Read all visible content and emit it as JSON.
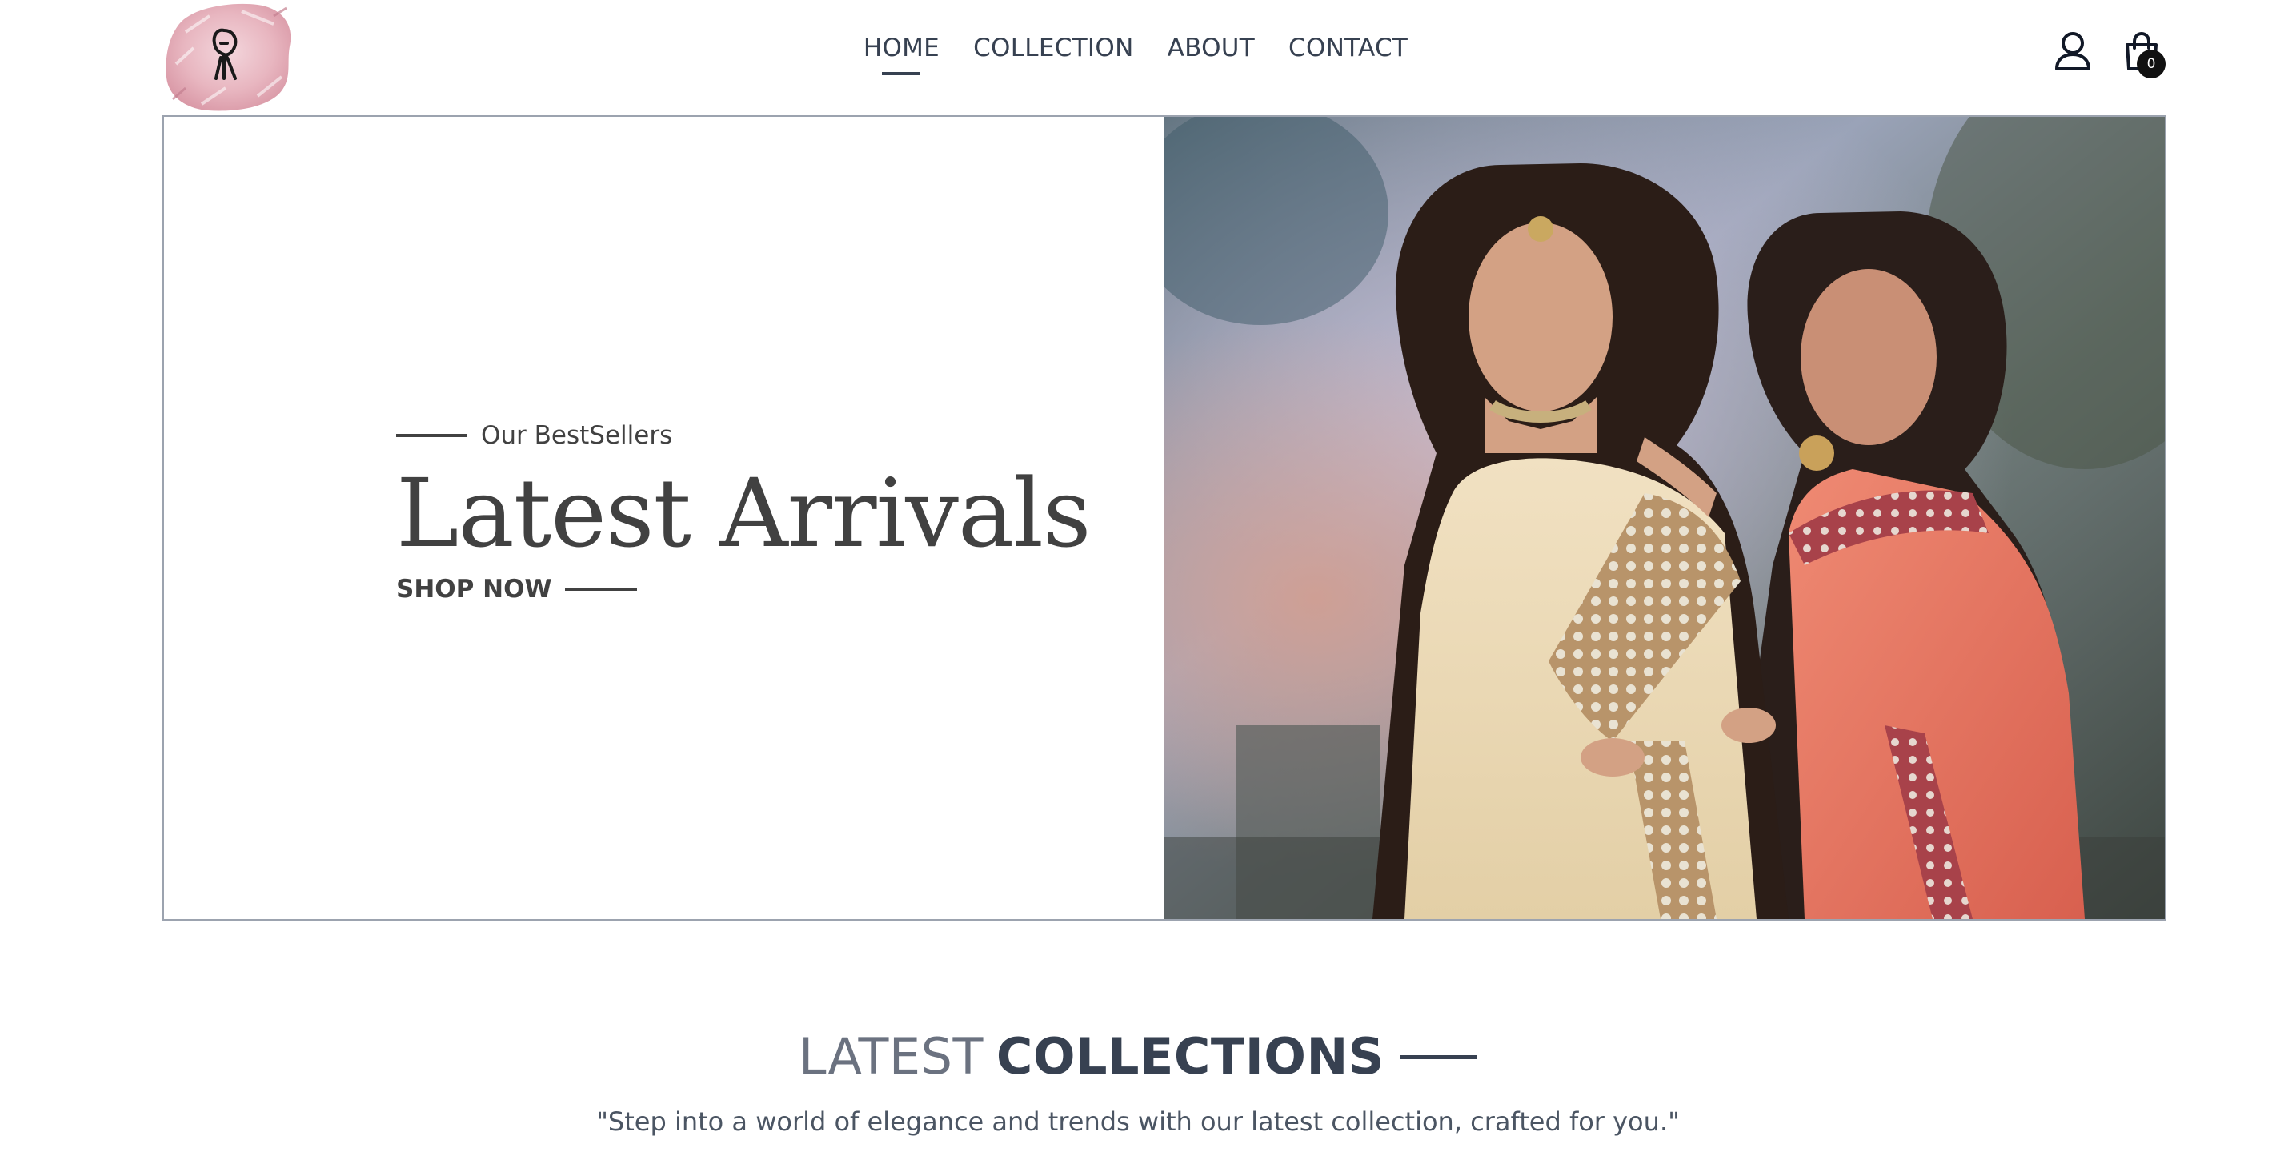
{
  "header": {
    "logo_name": "brand-logo",
    "nav": [
      {
        "label": "HOME",
        "active": true
      },
      {
        "label": "COLLECTION",
        "active": false
      },
      {
        "label": "ABOUT",
        "active": false
      },
      {
        "label": "CONTACT",
        "active": false
      }
    ],
    "icons": {
      "profile": "user-icon",
      "cart": "shopping-bag-icon"
    },
    "cart_count": "0"
  },
  "hero": {
    "eyebrow": "Our BestSellers",
    "title": "Latest Arrivals",
    "cta": "SHOP NOW",
    "image": "two-women-in-embroidered-sarees-photo"
  },
  "collections": {
    "title_light": "LATEST",
    "title_bold": "COLLECTIONS",
    "subtitle": "\"Step into a world of elegance and trends with our latest collection, crafted for you.\""
  },
  "colors": {
    "text_dark": "#374151",
    "text_muted": "#6b7280",
    "hero_text": "#414141",
    "border": "#9ca3af"
  }
}
